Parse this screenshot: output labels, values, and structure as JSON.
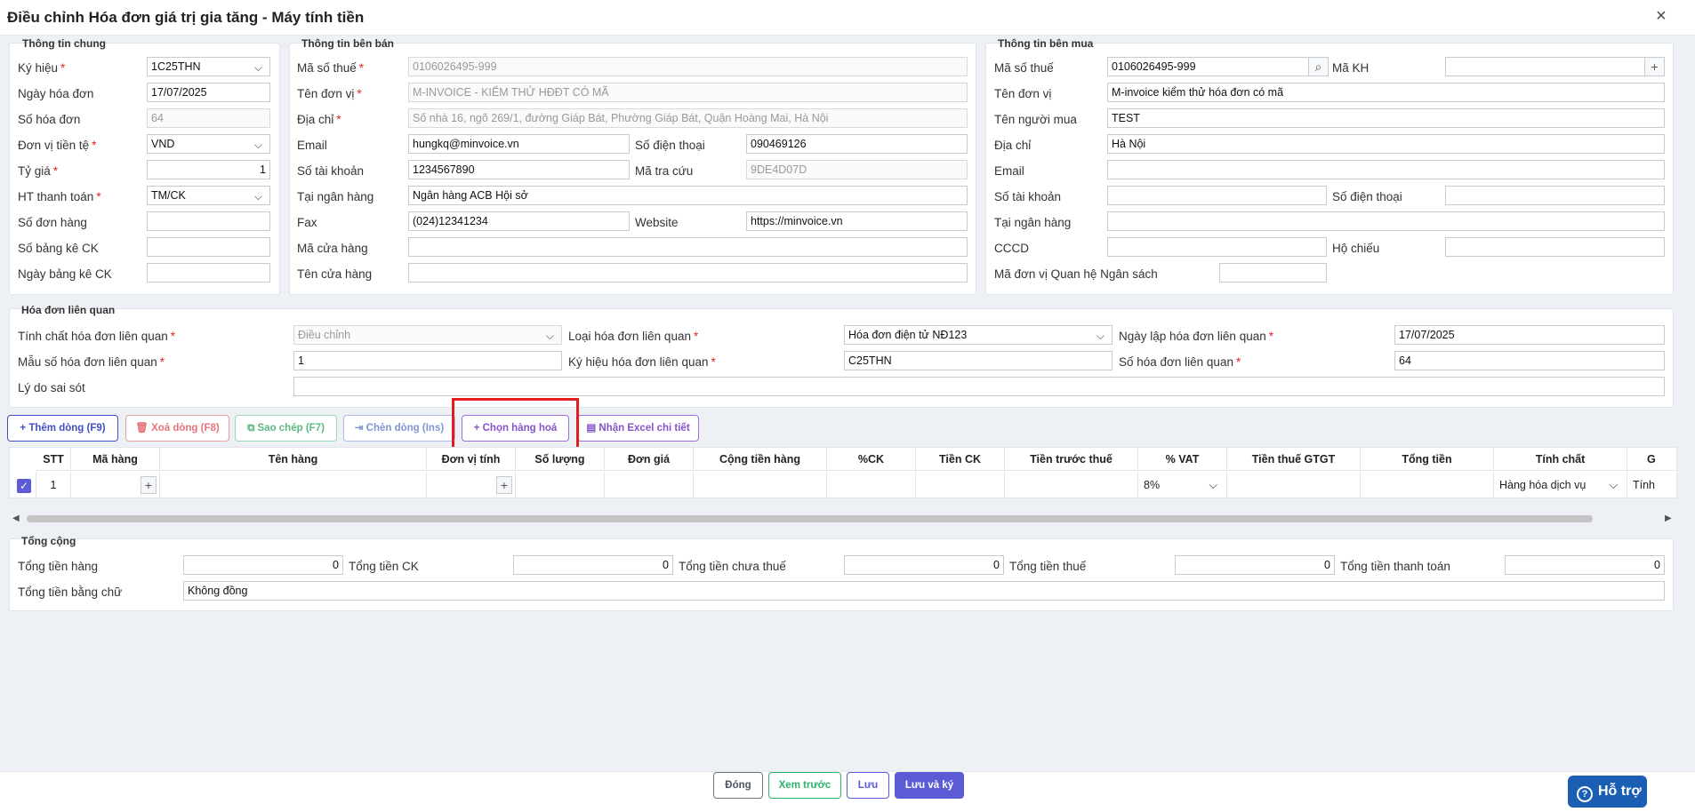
{
  "window": {
    "title": "Điều chỉnh Hóa đơn giá trị gia tăng - Máy tính tiền",
    "close_icon": "×"
  },
  "general": {
    "title": "Thông tin chung",
    "fields": [
      {
        "label": "Ký hiệu",
        "value": "1C25THN",
        "required": "*"
      },
      {
        "label": "Ngày hóa đơn",
        "value": "17/07/2025"
      },
      {
        "label": "Số hóa đơn",
        "value": "64"
      },
      {
        "label": "Đơn vị tiền tệ",
        "value": "VND",
        "required": "*"
      },
      {
        "label": "Tỷ giá",
        "value": "1",
        "required": "*"
      },
      {
        "label": "HT thanh toán",
        "value": "TM/CK",
        "required": "*"
      },
      {
        "label": "Số đơn hàng",
        "value": ""
      },
      {
        "label": "Số bảng kê CK",
        "value": ""
      },
      {
        "label": "Ngày bảng kê CK",
        "value": ""
      }
    ]
  },
  "seller": {
    "title": "Thông tin bên bán",
    "tax_code_label": "Mã số thuế",
    "tax_code": "0106026495-999",
    "name_label": "Tên đơn vị",
    "name": "M-INVOICE - KIỂM THỬ HĐĐT CÓ MÃ",
    "address_label": "Địa chỉ",
    "address": "Số nhà 16, ngõ 269/1, đường Giáp Bát, Phường Giáp Bát, Quận Hoàng Mai, Hà Nội",
    "email_label": "Email",
    "email": "hungkq@minvoice.vn",
    "phone_label": "Số điện thoại",
    "phone": "090469126",
    "account_label": "Số tài khoản",
    "account": "1234567890",
    "lookup_label": "Mã tra cứu",
    "lookup": "9DE4D07D",
    "bank_label": "Tại ngân hàng",
    "bank": "Ngân hàng ACB Hội sở",
    "fax_label": "Fax",
    "fax": "(024)12341234",
    "website_label": "Website",
    "website": "https://minvoice.vn",
    "store_code_label": "Mã cửa hàng",
    "store_code": "",
    "store_name_label": "Tên cửa hàng",
    "store_name": "",
    "required": "*"
  },
  "buyer": {
    "title": "Thông tin bên mua",
    "tax_code_label": "Mã số thuế",
    "tax_code": "0106026495-999",
    "customer_code_label": "Mã KH",
    "customer_code": "",
    "name_label": "Tên đơn vị",
    "name": "M-invoice kiểm thử hóa đơn có mã",
    "buyer_label": "Tên người mua",
    "buyer": "TEST",
    "address_label": "Địa chỉ",
    "address": "Hà Nội",
    "email_label": "Email",
    "email": "",
    "account_label": "Số tài khoản",
    "account": "",
    "phone_label": "Số điện thoại",
    "phone": "",
    "bank_label": "Tại ngân hàng",
    "bank": "",
    "id_label": "CCCD",
    "id": "",
    "passport_label": "Hộ chiếu",
    "passport": "",
    "budget_label": "Mã đơn vị Quan hệ Ngân sách",
    "budget": "",
    "search_icon": "⌕",
    "add_icon": "+"
  },
  "related": {
    "title": "Hóa đơn liên quan",
    "nature_label": "Tính chất hóa đơn liên quan",
    "nature": "Điều chỉnh",
    "type_label": "Loại hóa đơn liên quan",
    "type": "Hóa đơn điện tử NĐ123",
    "date_label": "Ngày lập hóa đơn liên quan",
    "date": "17/07/2025",
    "form_label": "Mẫu số hóa đơn liên quan",
    "form": "1",
    "symbol_label": "Ký hiệu hóa đơn liên quan",
    "symbol": "C25THN",
    "number_label": "Số hóa đơn liên quan",
    "number": "64",
    "reason_label": "Lý do sai sót",
    "reason": "",
    "required": "*"
  },
  "toolbar": {
    "add_row": "Thêm dòng (F9)",
    "add_icon": "+",
    "delete_row": "Xoá dòng (F8)",
    "delete_icon": "🗑",
    "copy": "Sao chép (F7)",
    "copy_icon": "⧉",
    "insert": "Chèn dòng (Ins)",
    "insert_icon": "⇥",
    "choose_goods": "Chọn hàng hoá",
    "choose_icon": "+",
    "import_excel": "Nhận Excel chi tiết",
    "excel_icon": "▤"
  },
  "grid": {
    "headers": [
      "STT",
      "Mã hàng",
      "Tên hàng",
      "Đơn vị tính",
      "Số lượng",
      "Đơn giá",
      "Cộng tiền hàng",
      "%CK",
      "Tiền CK",
      "Tiền trước thuế",
      "% VAT",
      "Tiền thuế GTGT",
      "Tổng tiền",
      "Tính chất",
      "G"
    ],
    "row": {
      "stt": "1",
      "vat": "8%",
      "nature": "Hàng hóa dịch vụ",
      "trailing": "Tính"
    }
  },
  "totals": {
    "title": "Tổng cộng",
    "goods_label": "Tổng tiền hàng",
    "goods": "0",
    "discount_label": "Tổng tiền CK",
    "discount": "0",
    "pretax_label": "Tổng tiền chưa thuế",
    "pretax": "0",
    "tax_label": "Tổng tiền thuế",
    "tax": "0",
    "payment_label": "Tổng tiền thanh toán",
    "payment": "0",
    "words_label": "Tổng tiền bằng chữ",
    "words": "Không đồng"
  },
  "footer": {
    "close": "Đóng",
    "preview": "Xem trước",
    "save": "Lưu",
    "save_sign": "Lưu và ký",
    "help": "Hỗ trợ",
    "help_icon": "?"
  },
  "colors": {
    "primary": "#5b5bd6",
    "danger": "#e5484d",
    "success": "#2fb36b",
    "highlight": "#e31c1c"
  }
}
